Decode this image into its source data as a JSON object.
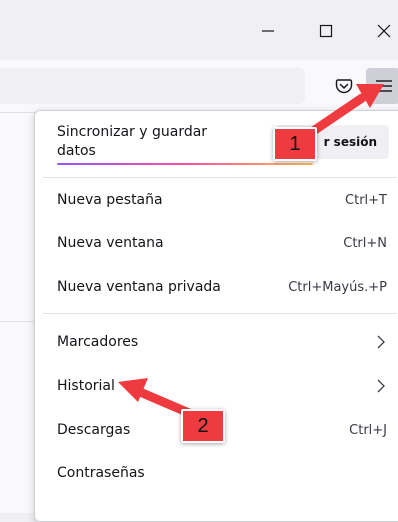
{
  "window_controls": {
    "minimize_icon": "minimize-icon",
    "maximize_icon": "maximize-icon",
    "close_icon": "close-icon"
  },
  "toolbar": {
    "pocket_icon": "pocket-icon",
    "menu_icon": "hamburger-menu-icon"
  },
  "app_menu": {
    "sync_label": "Sincronizar y guardar datos",
    "sign_in_label": "r sesión",
    "items": [
      {
        "label": "Nueva pestaña",
        "shortcut": "Ctrl+T"
      },
      {
        "label": "Nueva ventana",
        "shortcut": "Ctrl+N"
      },
      {
        "label": "Nueva ventana privada",
        "shortcut": "Ctrl+Mayús.+P"
      },
      {
        "label": "Marcadores",
        "shortcut": ""
      },
      {
        "label": "Historial",
        "shortcut": ""
      },
      {
        "label": "Descargas",
        "shortcut": "Ctrl+J"
      },
      {
        "label": "Contraseñas",
        "shortcut": ""
      }
    ]
  },
  "annotations": [
    {
      "label": "1",
      "color": "#ef3a3f"
    },
    {
      "label": "2",
      "color": "#ef3a3f"
    }
  ]
}
